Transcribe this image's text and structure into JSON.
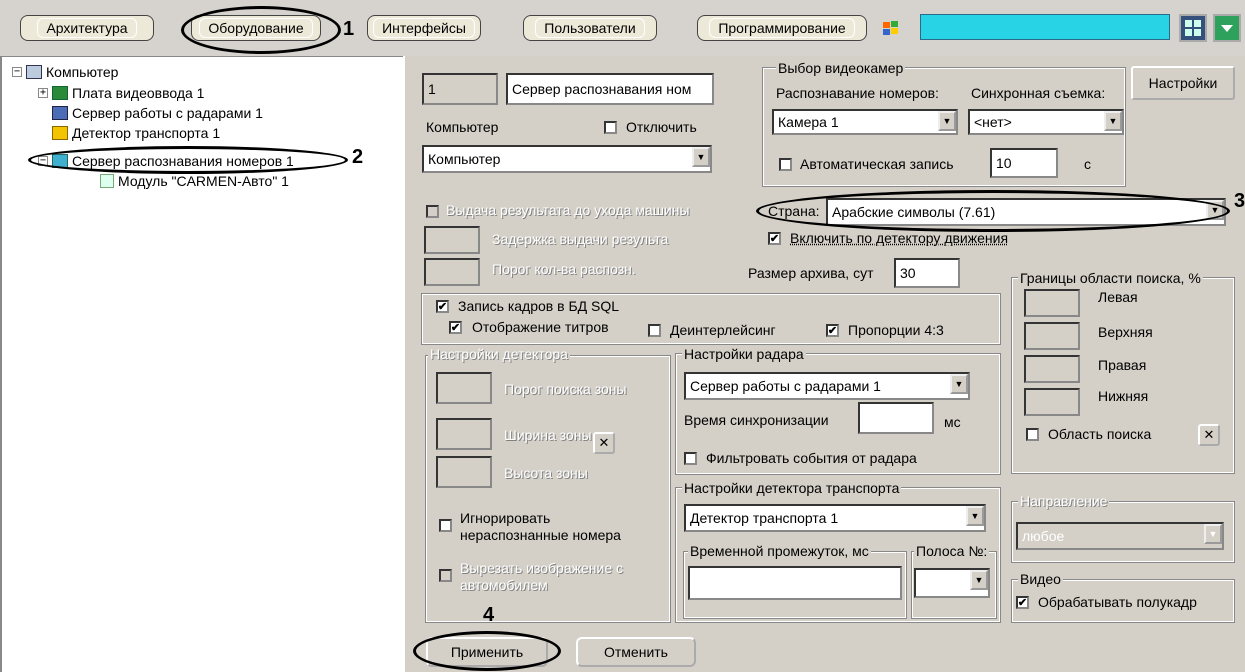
{
  "toolbar": {
    "tabs": [
      "Архитектура",
      "Оборудование",
      "Интерфейсы",
      "Пользователи",
      "Программирование"
    ]
  },
  "tree": {
    "items": [
      "Компьютер",
      "Плата видеоввода 1",
      "Сервер работы с радарами 1",
      "Детектор транспорта 1",
      "Сервер распознавания номеров 1",
      "Модуль \"CARMEN-Авто\" 1"
    ]
  },
  "form": {
    "id": "1",
    "name": "Сервер распознавания ном",
    "computer_label": "Компьютер",
    "disable_label": "Отключить",
    "computer_value": "Компьютер",
    "camera_group": "Выбор видеокамер",
    "recognition_label": "Распознавание номеров:",
    "sync_label": "Синхронная съемка:",
    "settings_button": "Настройки",
    "camera_value": "Камера 1",
    "sync_value": "<нет>",
    "autorecord_label": "Автоматическая запись",
    "autorecord_value": "10",
    "autorecord_unit": "с",
    "result_before_exit": "Выдача результата до ухода машины",
    "result_delay": "Задержка выдачи результа",
    "recog_threshold": "Порог кол-ва распозн.",
    "country_label": "Страна:",
    "country_value": "Арабские символы (7.61)",
    "motion_detector": "Включить по детектору движения",
    "archive_label": "Размер архива, сут",
    "archive_value": "30",
    "sql_record": "Запись кадров в БД SQL",
    "show_titles": "Отображение титров",
    "deinterlace": "Деинтерлейсинг",
    "aspect": "Пропорции 4:3",
    "search_bounds": "Границы области поиска, %",
    "left": "Левая",
    "top": "Верхняя",
    "right": "Правая",
    "bottom": "Нижняя",
    "search_area": "Область поиска",
    "detector_group": "Настройки детектора",
    "zone_threshold": "Порог поиска зоны",
    "zone_width": "Ширина зоны",
    "zone_height": "Высота зоны",
    "ignore_label": "Игнорировать нераспознанные номера",
    "cut_label": "Вырезать изображение с автомобилем",
    "radar_group": "Настройки радара",
    "radar_value": "Сервер работы с радарами 1",
    "sync_time": "Время синхронизации",
    "ms": "мс",
    "radar_filter": "Фильтровать события от радара",
    "transport_group": "Настройки детектора транспорта",
    "transport_value": "Детектор транспорта 1",
    "time_interval": "Временной промежуток, мс",
    "lane": "Полоса №:",
    "direction_group": "Направление",
    "direction_value": "любое",
    "video_group": "Видео",
    "half_frames": "Обрабатывать полукадр",
    "apply": "Применить",
    "cancel": "Отменить"
  },
  "callouts": [
    "1",
    "2",
    "3",
    "4"
  ]
}
